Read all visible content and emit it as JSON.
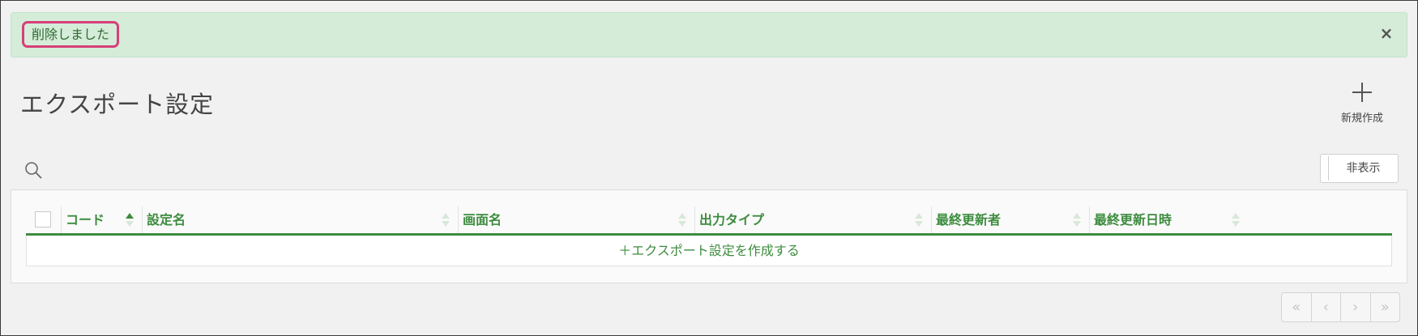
{
  "alert": {
    "message": "削除しました",
    "close_glyph": "×"
  },
  "page": {
    "title": "エクスポート設定"
  },
  "toolbar": {
    "new_label": "新規作成",
    "hide_label": "非表示"
  },
  "table": {
    "columns": [
      {
        "label": "コード",
        "sort": "asc"
      },
      {
        "label": "設定名",
        "sort": "none"
      },
      {
        "label": "画面名",
        "sort": "none"
      },
      {
        "label": "出力タイプ",
        "sort": "none"
      },
      {
        "label": "最終更新者",
        "sort": "none"
      },
      {
        "label": "最終更新日時",
        "sort": "none"
      }
    ],
    "create_row_label": "＋エクスポート設定を作成する"
  },
  "pagination": {
    "first": "«",
    "prev": "‹",
    "next": "›",
    "last": "»"
  },
  "colors": {
    "accent": "#3d8c3f",
    "alert_bg": "#d5ecd9",
    "highlight": "#d63f79"
  },
  "icons": {
    "new": "plus-icon",
    "search": "search-icon",
    "close": "close-icon"
  }
}
